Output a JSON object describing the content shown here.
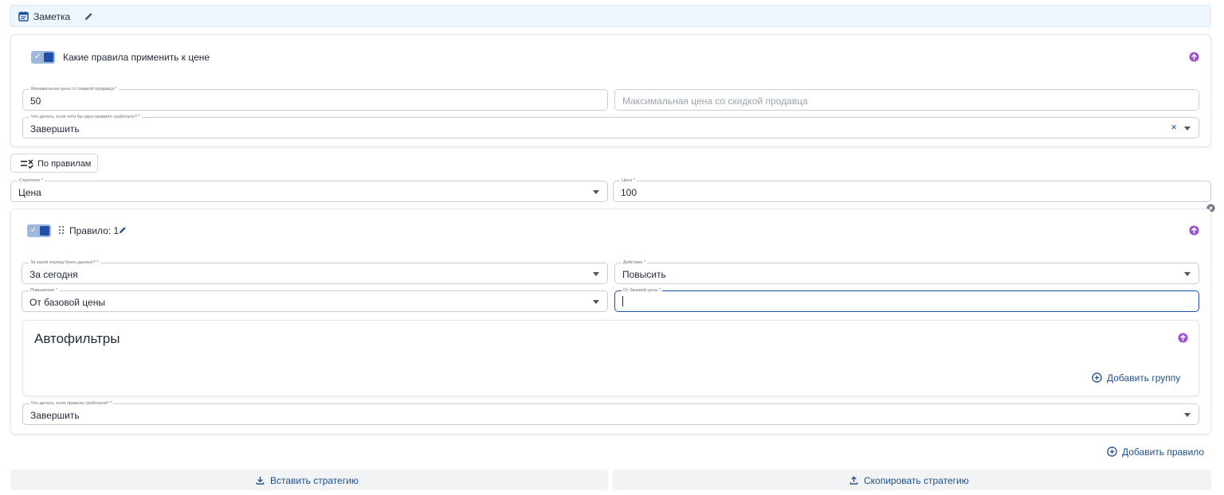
{
  "note": {
    "label": "Заметка"
  },
  "rules_card": {
    "heading": "Какие правила применить к цене",
    "min_price": {
      "label": "Минимальная цена со скидкой продавца *",
      "value": "50"
    },
    "max_price": {
      "placeholder": "Максимальная цена со скидкой продавца"
    },
    "on_match": {
      "label": "Что делать, если хотя бы одно правило сработало? *",
      "value": "Завершить"
    }
  },
  "by_rules_button": {
    "label": "По правилам"
  },
  "strategy": {
    "label": "Стратегия *",
    "value": "Цена"
  },
  "price": {
    "label": "Цена *",
    "value": "100"
  },
  "rule": {
    "title": "Правило: 1",
    "period": {
      "label": "За какой период брать данные? *",
      "value": "За сегодня"
    },
    "action": {
      "label": "Действие *",
      "value": "Повысить"
    },
    "raise": {
      "label": "Повышение *",
      "value": "От базовой цены"
    },
    "from_base": {
      "label": "От базовой цены *",
      "value": ""
    },
    "autofilters": {
      "title": "Автофильтры",
      "add_group": "Добавить группу"
    },
    "on_rules": {
      "label": "Что делать, если правила сработали? *",
      "value": "Завершить"
    }
  },
  "add_rule": "Добавить правило",
  "paste_strategy": "Вставить стратегию",
  "copy_strategy": "Скопировать стратегию",
  "colors": {
    "accent": "#1f4fa6",
    "purple": "#9b4fd6",
    "link": "#1f4f8c"
  }
}
